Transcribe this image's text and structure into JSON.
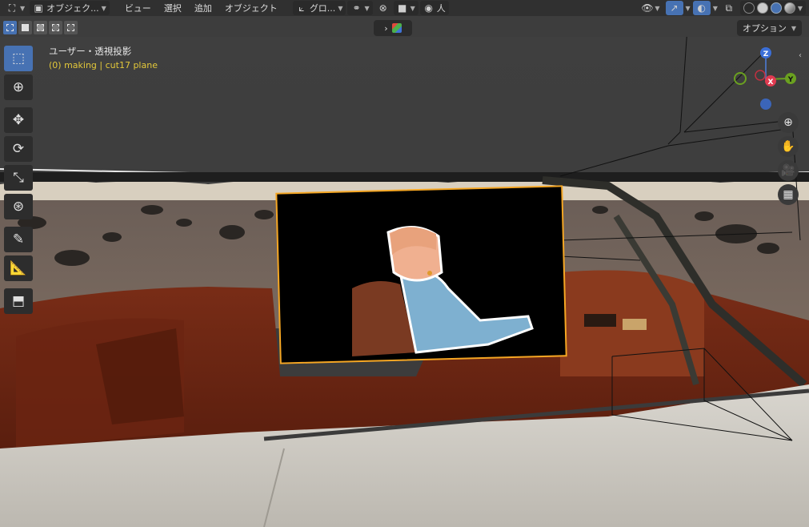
{
  "header": {
    "editor_label": "",
    "mode_label": "オブジェク...",
    "menus": [
      "ビュー",
      "選択",
      "追加",
      "オブジェクト"
    ],
    "transform_orientation": "グロ...",
    "proportional_label": "人"
  },
  "toolbar_row": {
    "options_label": "オプション"
  },
  "viewport": {
    "view_title": "ユーザー・透視投影",
    "object_info": "(0) making | cut17 plane"
  },
  "gizmo": {
    "z_label": "Z",
    "x_label": "X",
    "y_label": "Y"
  },
  "colors": {
    "accent": "#4772b3",
    "selection_outline": "#f5a623",
    "info_text": "#e3c83a"
  },
  "icons": {
    "tools": [
      "select-box-icon",
      "cursor-icon",
      "move-icon",
      "rotate-icon",
      "scale-icon",
      "transform-icon",
      "annotate-icon",
      "measure-icon",
      "add-cube-icon"
    ],
    "nav": [
      "zoom-icon",
      "hand-icon",
      "camera-icon",
      "grid-icon"
    ]
  }
}
